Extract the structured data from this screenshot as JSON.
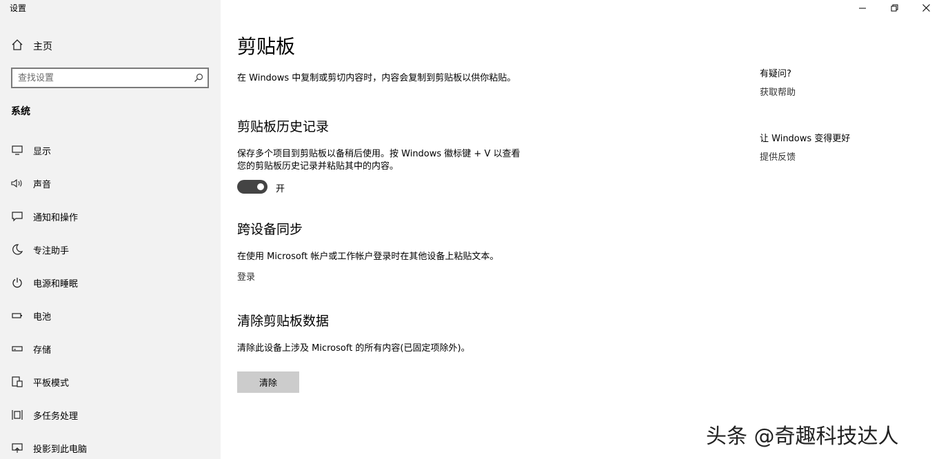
{
  "window": {
    "title": "设置",
    "controls": [
      "minimize-icon",
      "restore-icon",
      "close-icon"
    ]
  },
  "sidebar": {
    "home_label": "主页",
    "search_placeholder": "查找设置",
    "group_title": "系统",
    "items": [
      {
        "label": "显示",
        "icon": "display-icon"
      },
      {
        "label": "声音",
        "icon": "speaker-icon"
      },
      {
        "label": "通知和操作",
        "icon": "notification-icon"
      },
      {
        "label": "专注助手",
        "icon": "moon-icon"
      },
      {
        "label": "电源和睡眠",
        "icon": "power-icon"
      },
      {
        "label": "电池",
        "icon": "battery-icon"
      },
      {
        "label": "存储",
        "icon": "storage-icon"
      },
      {
        "label": "平板模式",
        "icon": "tablet-mode-icon"
      },
      {
        "label": "多任务处理",
        "icon": "multitasking-icon"
      },
      {
        "label": "投影到此电脑",
        "icon": "projecting-icon"
      }
    ]
  },
  "main": {
    "title": "剪贴板",
    "intro": "在 Windows 中复制或剪切内容时，内容会复制到剪贴板以供你粘贴。",
    "history": {
      "title": "剪贴板历史记录",
      "desc_line1": "保存多个项目到剪贴板以备稍后使用。按 Windows 徽标键 + V 以查看",
      "desc_line2": "您的剪贴板历史记录并粘贴其中的内容。",
      "toggle_state": "开"
    },
    "sync": {
      "title": "跨设备同步",
      "desc": "在使用 Microsoft 帐户或工作帐户登录时在其他设备上粘贴文本。",
      "link": "登录"
    },
    "clear": {
      "title": "清除剪贴板数据",
      "desc": "清除此设备上涉及 Microsoft 的所有内容(已固定项除外)。",
      "button": "清除"
    }
  },
  "right_panel": {
    "question_title": "有疑问?",
    "help_link": "获取帮助",
    "improve_title": "让 Windows 变得更好",
    "feedback_link": "提供反馈"
  },
  "watermark": "头条 @奇趣科技达人"
}
